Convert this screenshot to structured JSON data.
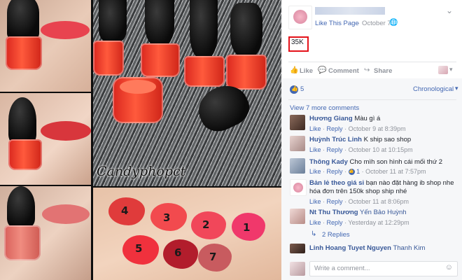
{
  "photo": {
    "watermark": "Candyphopct",
    "swatch_numbers": [
      "4",
      "3",
      "2",
      "1",
      "5",
      "6",
      "7"
    ],
    "swatch_colors": [
      "#e03b3b",
      "#f24a4e",
      "#f1475a",
      "#f0386b",
      "#f0313d",
      "#b21d2c",
      "#c85b5f"
    ]
  },
  "post": {
    "page_name": "",
    "like_page_label": "Like This Page",
    "sep": "·",
    "date": "October 7",
    "text": "35K",
    "chevron": "⌄"
  },
  "actions": {
    "like": "Like",
    "comment": "Comment",
    "share": "Share"
  },
  "reactions": {
    "count": "5",
    "sort_label": "Chronological"
  },
  "view_more": "View 7 more comments",
  "comments": [
    {
      "author": "Hương Giang",
      "text": "Màu gì á",
      "like": "Like",
      "reply": "Reply",
      "time": "October 9 at 8:39pm"
    },
    {
      "author": "Huỳnh Trúc Linh",
      "text": "K ship sao shop",
      "like": "Like",
      "reply": "Reply",
      "time": "October 10 at 10:15pm"
    },
    {
      "author": "Thông Kady",
      "text": "Cho mìh son hình cái mối thứ 2",
      "like": "Like",
      "reply": "Reply",
      "likes": "1",
      "time": "October 11 at 7:57pm"
    },
    {
      "author": "Bản lẻ theo giá sỉ",
      "text": "bạn nào đặt hàng ib shop nhe hóa đơn trên 150k shop ship nhé",
      "like": "Like",
      "reply": "Reply",
      "time": "October 11 at 8:06pm"
    },
    {
      "author": "Nt Thu Thương",
      "text": "Yến Bảo Huỳnh",
      "like": "Like",
      "reply": "Reply",
      "time": "Yesterday at 12:29pm"
    }
  ],
  "replies_label": "2 Replies",
  "last_comment": {
    "author": "Linh Hoang Tuyet Nguyen",
    "text": "Thanh Kim"
  },
  "composer": {
    "placeholder": "Write a comment..."
  },
  "separator": "·",
  "colors": {
    "link_blue": "#4267b2",
    "name_blue": "#385898",
    "highlight_red": "#e4121a"
  }
}
